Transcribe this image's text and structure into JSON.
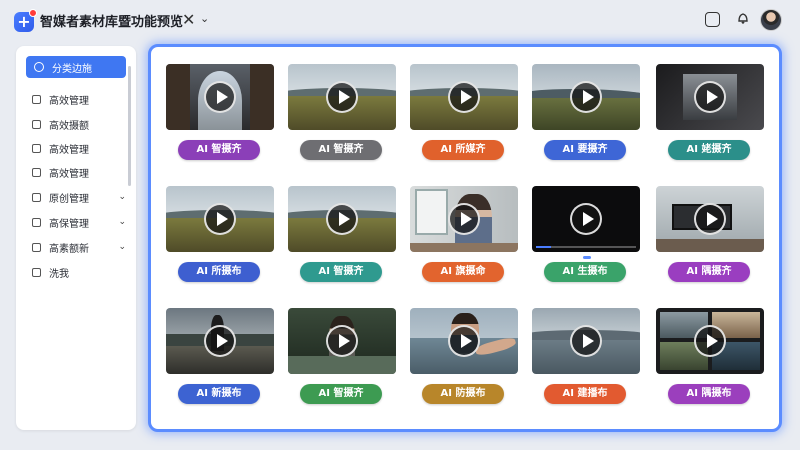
{
  "app": {
    "title": "智媒者素材库暨功能预览",
    "close_icon": "✕",
    "chevron_icon": "⌄",
    "square_icon": "▢",
    "bell_icon": "♫",
    "logo_glyph": "+"
  },
  "sidebar": {
    "items": [
      {
        "label": "分类边施",
        "active": true,
        "has_chevron": false
      },
      {
        "label": "高效管理",
        "active": false,
        "has_chevron": false
      },
      {
        "label": "高效摄额",
        "active": false,
        "has_chevron": false
      },
      {
        "label": "高效管理",
        "active": false,
        "has_chevron": false
      },
      {
        "label": "高效管理",
        "active": false,
        "has_chevron": false
      },
      {
        "label": "原创管理",
        "active": false,
        "has_chevron": true
      },
      {
        "label": "高保管理",
        "active": false,
        "has_chevron": true
      },
      {
        "label": "高素额新",
        "active": false,
        "has_chevron": true
      },
      {
        "label": "洗我",
        "active": false,
        "has_chevron": false
      }
    ]
  },
  "colors": {
    "accent": "#3f77f2",
    "panel_border": "#5b8cff"
  },
  "grid": {
    "rows": [
      [
        {
          "label": "AI 智摄齐",
          "color": "#8b3fb8",
          "scene": "arch"
        },
        {
          "label": "AI 智摄齐",
          "color": "#6e6e72",
          "scene": "grass"
        },
        {
          "label": "AI 所媒齐",
          "color": "#e0612c",
          "scene": "grass"
        },
        {
          "label": "AI 要摄齐",
          "color": "#3e66d6",
          "scene": "hills"
        },
        {
          "label": "AI 姥摄齐",
          "color": "#2b8f8a",
          "scene": "dark"
        }
      ],
      [
        {
          "label": "AI 所摄布",
          "color": "#3e5fd0",
          "scene": "grass"
        },
        {
          "label": "AI 智摄齐",
          "color": "#2f9a8f",
          "scene": "grass"
        },
        {
          "label": "AI 旗摄命",
          "color": "#e2642e",
          "scene": "person"
        },
        {
          "label": "AI 生摄布",
          "color": "#3aa36a",
          "scene": "black"
        },
        {
          "label": "AI 隅摄齐",
          "color": "#9a3ec0",
          "scene": "desk"
        }
      ],
      [
        {
          "label": "AI 新摄布",
          "color": "#3d63d2",
          "scene": "road"
        },
        {
          "label": "AI 智摄齐",
          "color": "#3d9b52",
          "scene": "forest"
        },
        {
          "label": "AI 防摄布",
          "color": "#b8862a",
          "scene": "selfie"
        },
        {
          "label": "AI 建播布",
          "color": "#e25a30",
          "scene": "lake"
        },
        {
          "label": "AI 隅摄布",
          "color": "#9b3fbd",
          "scene": "collage"
        }
      ]
    ]
  }
}
